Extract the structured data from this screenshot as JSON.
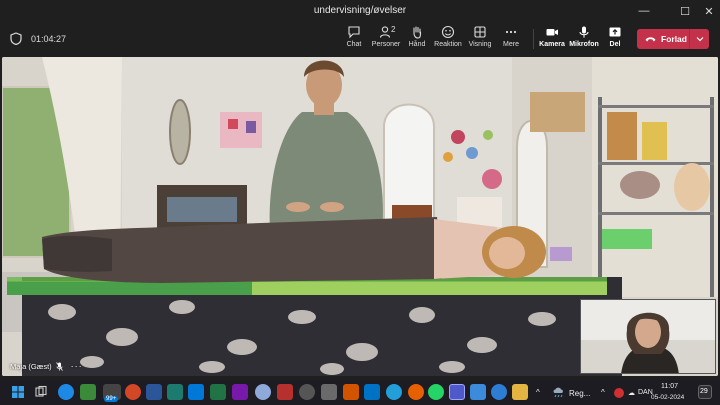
{
  "window": {
    "title": "undervisning/øvelser",
    "minimize": "—",
    "maximize": "☐",
    "close": "✕"
  },
  "meeting": {
    "timer": "01:04:27",
    "buttons": {
      "chat": "Chat",
      "people": "Personer",
      "people_count": "2",
      "raise_hand": "Hånd",
      "reactions": "Reaktion",
      "view": "Visning",
      "more": "Mere",
      "camera": "Kamera",
      "mic": "Mikrofon",
      "share": "Del"
    },
    "leave_label": "Forlad",
    "leave_color": "#c4314b"
  },
  "video": {
    "participant_name": "Maja (Gæst)"
  },
  "taskbar": {
    "badge_count": "99+",
    "weather_text": "Reg...",
    "language": "DAN",
    "time": "11:07",
    "date": "05-02-2024",
    "notification_count": "29"
  }
}
